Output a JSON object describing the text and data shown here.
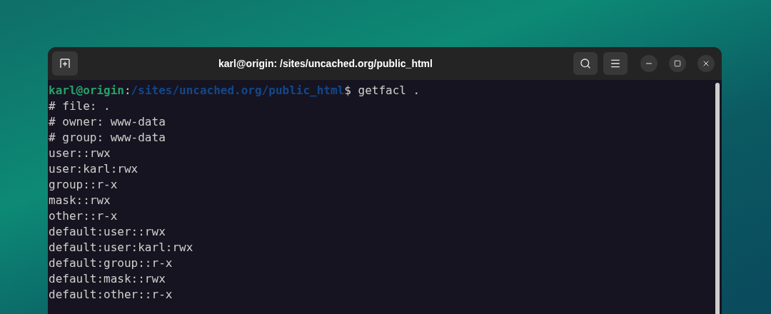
{
  "window": {
    "title": "karl@origin: /sites/uncached.org/public_html"
  },
  "terminal": {
    "prompt": {
      "user_host": "karl@origin",
      "separator": ":",
      "path": "/sites/uncached.org/public_html",
      "command": "$ getfacl ."
    },
    "output": [
      "# file: .",
      "# owner: www-data",
      "# group: www-data",
      "user::rwx",
      "user:karl:rwx",
      "group::r-x",
      "mask::rwx",
      "other::r-x",
      "default:user::rwx",
      "default:user:karl:rwx",
      "default:group::r-x",
      "default:mask::rwx",
      "default:other::r-x"
    ]
  }
}
